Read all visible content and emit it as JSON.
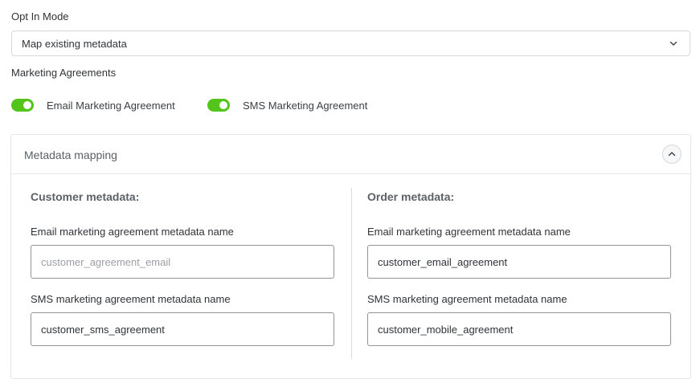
{
  "opt_in": {
    "label": "Opt In Mode",
    "selected": "Map existing metadata",
    "chevron_icon": "chevron-down-icon"
  },
  "marketing": {
    "label": "Marketing Agreements",
    "toggles": [
      {
        "label": "Email Marketing Agreement",
        "on": true
      },
      {
        "label": "SMS Marketing Agreement",
        "on": true
      }
    ],
    "toggle_color": "#52c41a"
  },
  "mapping": {
    "title": "Metadata mapping",
    "collapse_icon": "chevron-up-icon",
    "customer": {
      "title": "Customer metadata:",
      "email_label": "Email marketing agreement metadata name",
      "email_value": "",
      "email_placeholder": "customer_agreement_email",
      "sms_label": "SMS marketing agreement metadata name",
      "sms_value": "customer_sms_agreement"
    },
    "order": {
      "title": "Order metadata:",
      "email_label": "Email marketing agreement metadata name",
      "email_value": "customer_email_agreement",
      "sms_label": "SMS marketing agreement metadata name",
      "sms_value": "customer_mobile_agreement"
    }
  }
}
